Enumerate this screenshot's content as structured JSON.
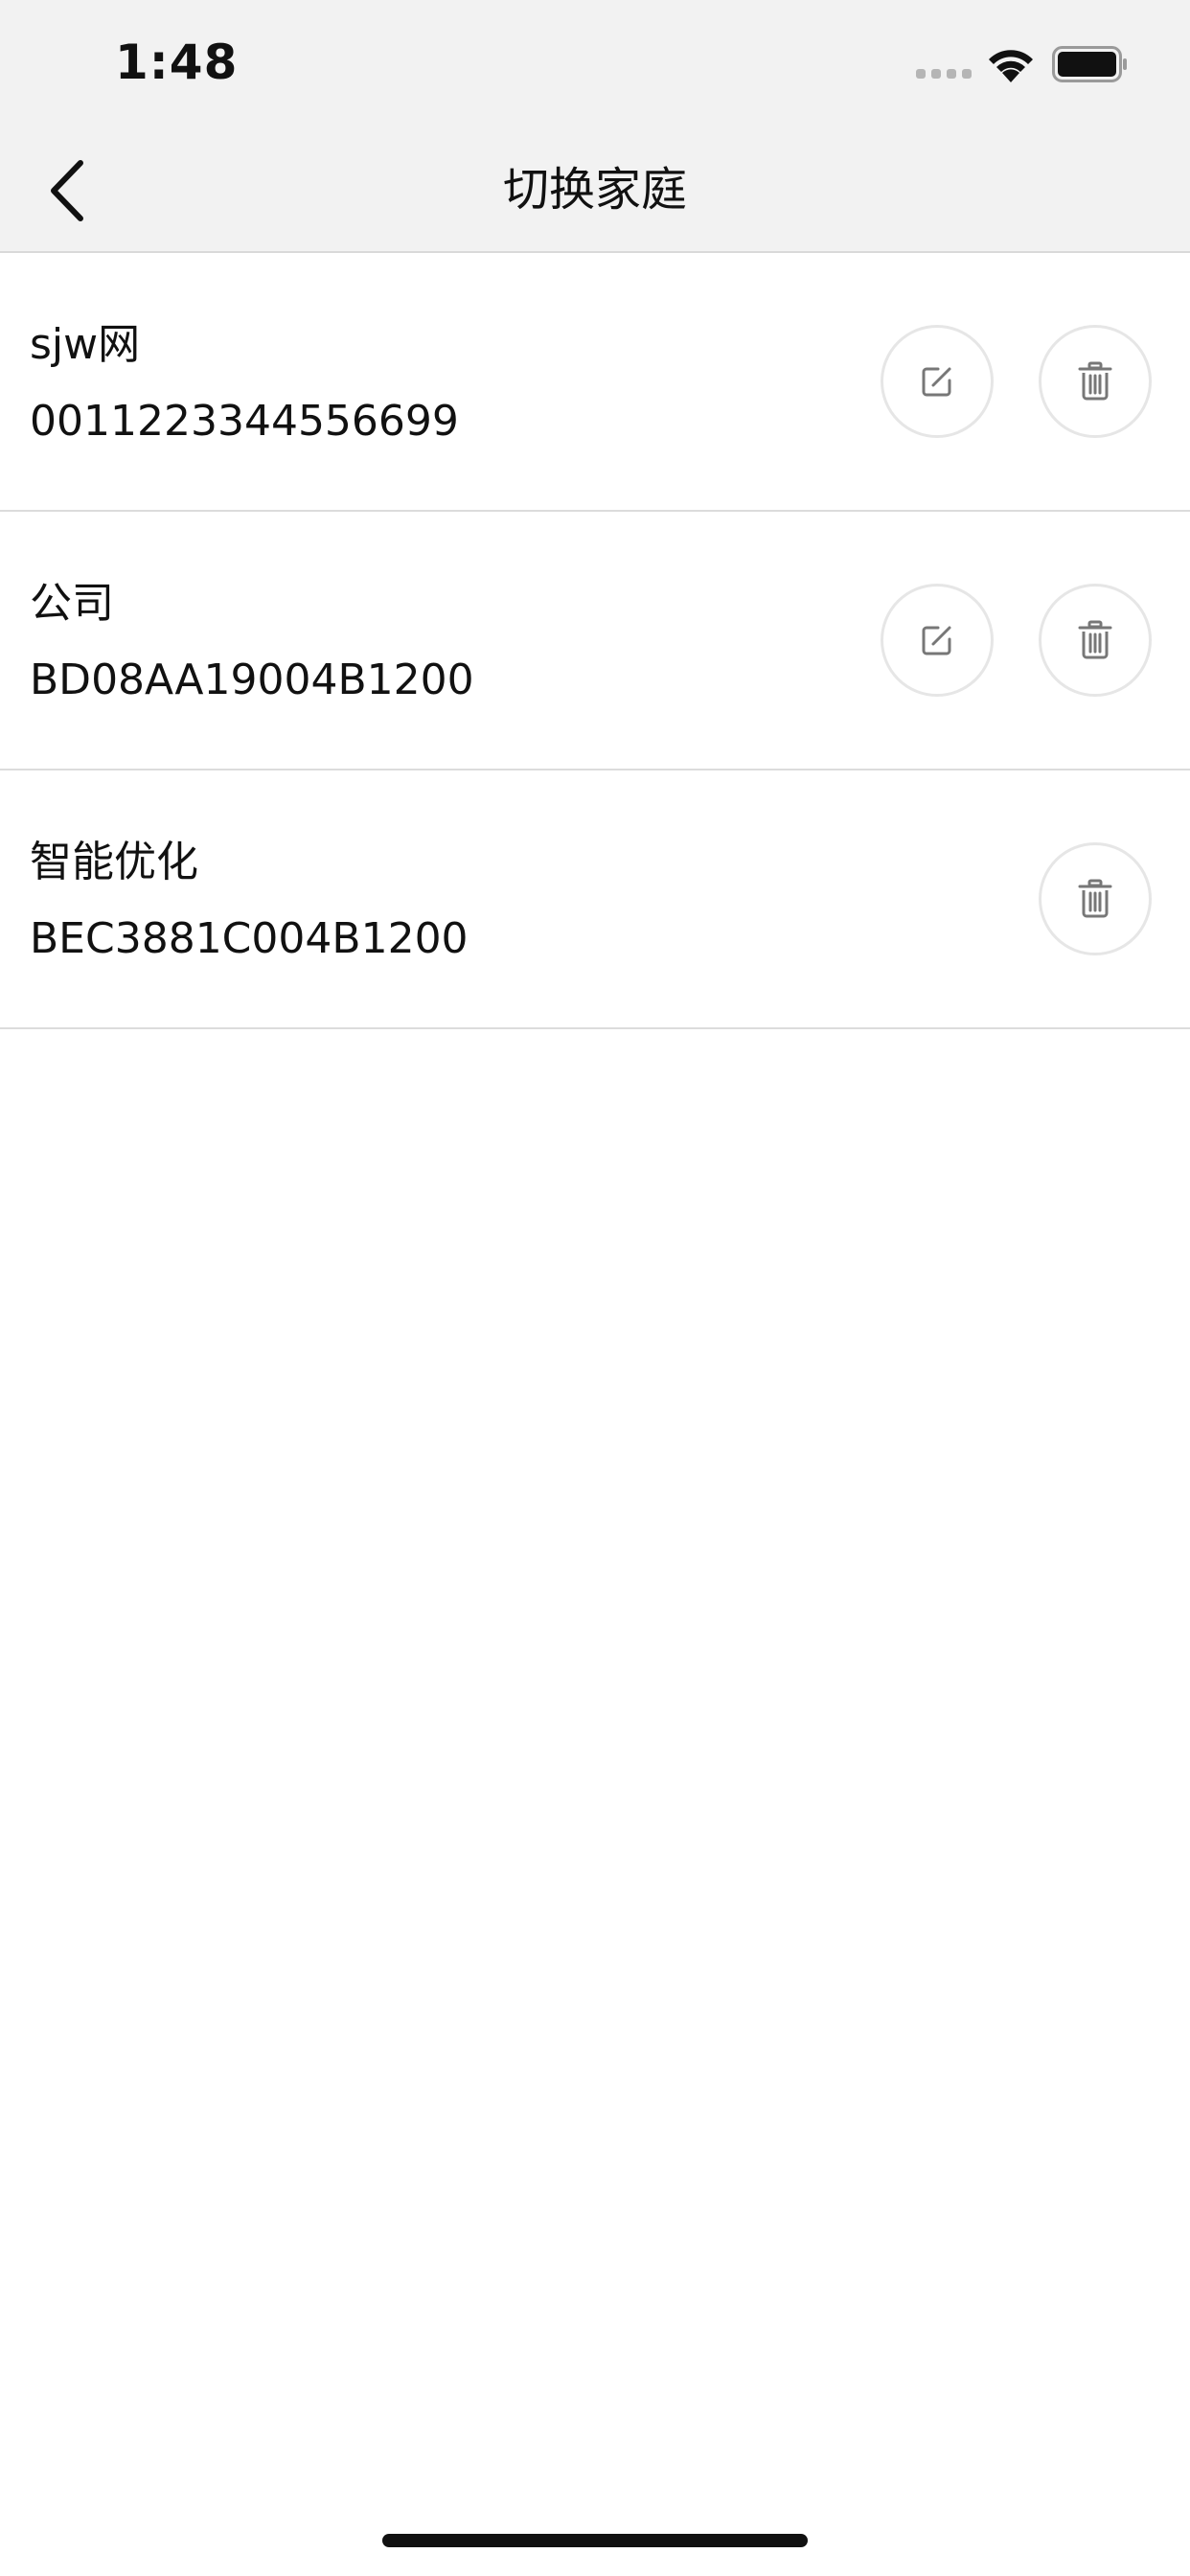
{
  "status_bar": {
    "time": "1:48"
  },
  "header": {
    "title": "切换家庭",
    "back_icon": "chevron-left-icon"
  },
  "families": [
    {
      "name": "sjw网",
      "id": "0011223344556699",
      "can_edit": true
    },
    {
      "name": "公司",
      "id": "BD08AA19004B1200",
      "can_edit": true
    },
    {
      "name": "智能优化",
      "id": "BEC3881C004B1200",
      "can_edit": false
    }
  ],
  "icons": {
    "edit": "edit-icon",
    "delete": "trash-icon"
  },
  "colors": {
    "header_bg": "#f2f2f2",
    "divider": "#dcdcdc",
    "button_border": "#e6e6e6",
    "icon_gray": "#777777"
  }
}
